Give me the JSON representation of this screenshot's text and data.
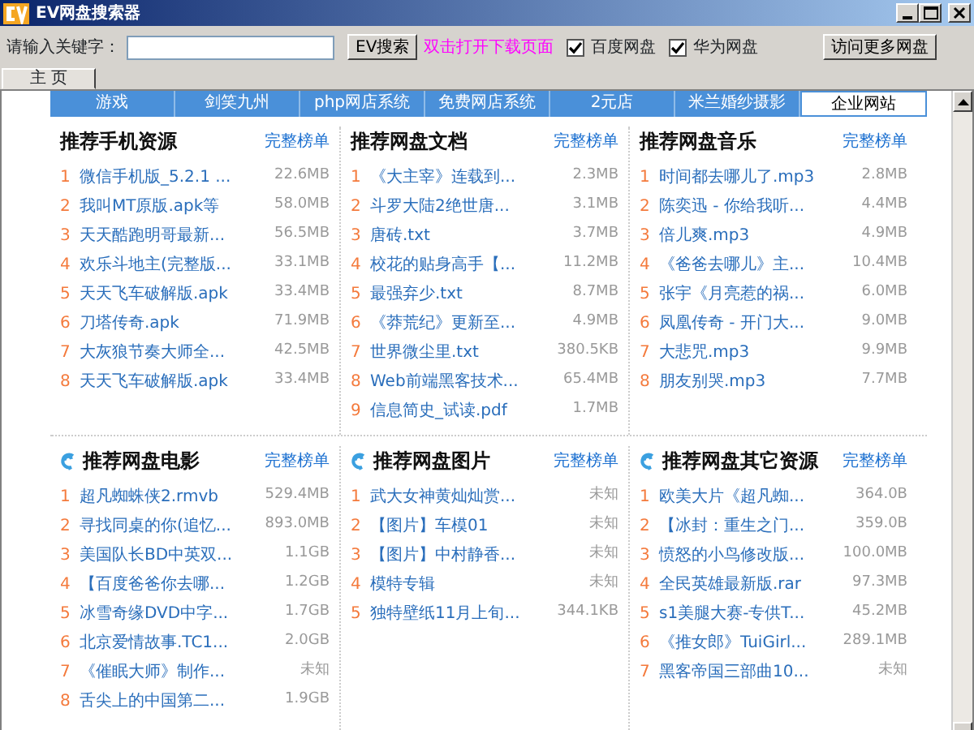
{
  "window": {
    "title": "EV网盘搜索器"
  },
  "toolbar": {
    "keyword_label": "请输入关键字：",
    "search_button": "EV搜索",
    "hint": "双击打开下载页面",
    "checkboxes": [
      {
        "label": "百度网盘",
        "checked": true
      },
      {
        "label": "华为网盘",
        "checked": true
      }
    ],
    "more_button": "访问更多网盘"
  },
  "tabs": [
    {
      "label": "主 页",
      "selected": true
    }
  ],
  "nav": [
    {
      "label": "游戏",
      "selected": false
    },
    {
      "label": "剑笑九州",
      "selected": false
    },
    {
      "label": "php网店系统",
      "selected": false
    },
    {
      "label": "免费网店系统",
      "selected": false
    },
    {
      "label": "2元店",
      "selected": false
    },
    {
      "label": "米兰婚纱摄影",
      "selected": false
    },
    {
      "label": "企业网站",
      "selected": true
    }
  ],
  "sections": [
    {
      "title": "推荐手机资源",
      "more_link": "完整榜单",
      "has_icon": false,
      "items": [
        {
          "rank": "1",
          "name": "微信手机版_5.2.1 ...",
          "size": "22.6MB"
        },
        {
          "rank": "2",
          "name": "我叫MT原版.apk等",
          "size": "58.0MB"
        },
        {
          "rank": "3",
          "name": "天天酷跑明哥最新...",
          "size": "56.5MB"
        },
        {
          "rank": "4",
          "name": "欢乐斗地主(完整版...",
          "size": "33.1MB"
        },
        {
          "rank": "5",
          "name": "天天飞车破解版.apk",
          "size": "33.4MB"
        },
        {
          "rank": "6",
          "name": "刀塔传奇.apk",
          "size": "71.9MB"
        },
        {
          "rank": "7",
          "name": "大灰狼节奏大师全...",
          "size": "42.5MB"
        },
        {
          "rank": "8",
          "name": "天天飞车破解版.apk",
          "size": "33.4MB"
        }
      ]
    },
    {
      "title": "推荐网盘文档",
      "more_link": "完整榜单",
      "has_icon": false,
      "items": [
        {
          "rank": "1",
          "name": "《大主宰》连载到...",
          "size": "2.3MB"
        },
        {
          "rank": "2",
          "name": "斗罗大陆2绝世唐...",
          "size": "3.1MB"
        },
        {
          "rank": "3",
          "name": "唐砖.txt",
          "size": "3.7MB"
        },
        {
          "rank": "4",
          "name": "校花的贴身高手【...",
          "size": "11.2MB"
        },
        {
          "rank": "5",
          "name": "最强弃少.txt",
          "size": "8.7MB"
        },
        {
          "rank": "6",
          "name": "《莽荒纪》更新至...",
          "size": "4.9MB"
        },
        {
          "rank": "7",
          "name": "世界微尘里.txt",
          "size": "380.5KB"
        },
        {
          "rank": "8",
          "name": "Web前端黑客技术...",
          "size": "65.4MB"
        },
        {
          "rank": "9",
          "name": "信息简史_试读.pdf",
          "size": "1.7MB"
        }
      ]
    },
    {
      "title": "推荐网盘音乐",
      "more_link": "完整榜单",
      "has_icon": false,
      "items": [
        {
          "rank": "1",
          "name": "时间都去哪儿了.mp3",
          "size": "2.8MB"
        },
        {
          "rank": "2",
          "name": "陈奕迅 - 你给我听...",
          "size": "4.4MB"
        },
        {
          "rank": "3",
          "name": "倍儿爽.mp3",
          "size": "4.9MB"
        },
        {
          "rank": "4",
          "name": "《爸爸去哪儿》主...",
          "size": "10.4MB"
        },
        {
          "rank": "5",
          "name": "张宇《月亮惹的祸...",
          "size": "6.0MB"
        },
        {
          "rank": "6",
          "name": "凤凰传奇 - 开门大...",
          "size": "9.0MB"
        },
        {
          "rank": "7",
          "name": "大悲咒.mp3",
          "size": "9.9MB"
        },
        {
          "rank": "8",
          "name": "朋友别哭.mp3",
          "size": "7.7MB"
        }
      ]
    },
    {
      "title": "推荐网盘电影",
      "more_link": "完整榜单",
      "has_icon": true,
      "items": [
        {
          "rank": "1",
          "name": "超凡蜘蛛侠2.rmvb",
          "size": "529.4MB"
        },
        {
          "rank": "2",
          "name": "寻找同桌的你(追忆...",
          "size": "893.0MB"
        },
        {
          "rank": "3",
          "name": "美国队长BD中英双...",
          "size": "1.1GB"
        },
        {
          "rank": "4",
          "name": "【百度爸爸你去哪...",
          "size": "1.2GB"
        },
        {
          "rank": "5",
          "name": "冰雪奇缘DVD中字...",
          "size": "1.7GB"
        },
        {
          "rank": "6",
          "name": "北京爱情故事.TC1...",
          "size": "2.0GB"
        },
        {
          "rank": "7",
          "name": "《催眠大师》制作...",
          "size": "未知"
        },
        {
          "rank": "8",
          "name": "舌尖上的中国第二...",
          "size": "1.9GB"
        }
      ]
    },
    {
      "title": "推荐网盘图片",
      "more_link": "完整榜单",
      "has_icon": true,
      "items": [
        {
          "rank": "1",
          "name": "武大女神黄灿灿赏...",
          "size": "未知"
        },
        {
          "rank": "2",
          "name": "【图片】车模01",
          "size": "未知"
        },
        {
          "rank": "3",
          "name": "【图片】中村静香...",
          "size": "未知"
        },
        {
          "rank": "4",
          "name": "模特专辑",
          "size": "未知"
        },
        {
          "rank": "5",
          "name": "独特壁纸11月上旬...",
          "size": "344.1KB"
        }
      ]
    },
    {
      "title": "推荐网盘其它资源",
      "more_link": "完整榜单",
      "has_icon": true,
      "items": [
        {
          "rank": "1",
          "name": "欧美大片《超凡蜘...",
          "size": "364.0B"
        },
        {
          "rank": "2",
          "name": "【冰封：重生之门...",
          "size": "359.0B"
        },
        {
          "rank": "3",
          "name": "愤怒的小鸟修改版...",
          "size": "100.0MB"
        },
        {
          "rank": "4",
          "name": "全民英雄最新版.rar",
          "size": "97.3MB"
        },
        {
          "rank": "5",
          "name": "s1美腿大赛-专供T...",
          "size": "45.2MB"
        },
        {
          "rank": "6",
          "name": "《推女郎》TuiGirl...",
          "size": "289.1MB"
        },
        {
          "rank": "7",
          "name": "黑客帝国三部曲10...",
          "size": "未知"
        }
      ]
    }
  ]
}
